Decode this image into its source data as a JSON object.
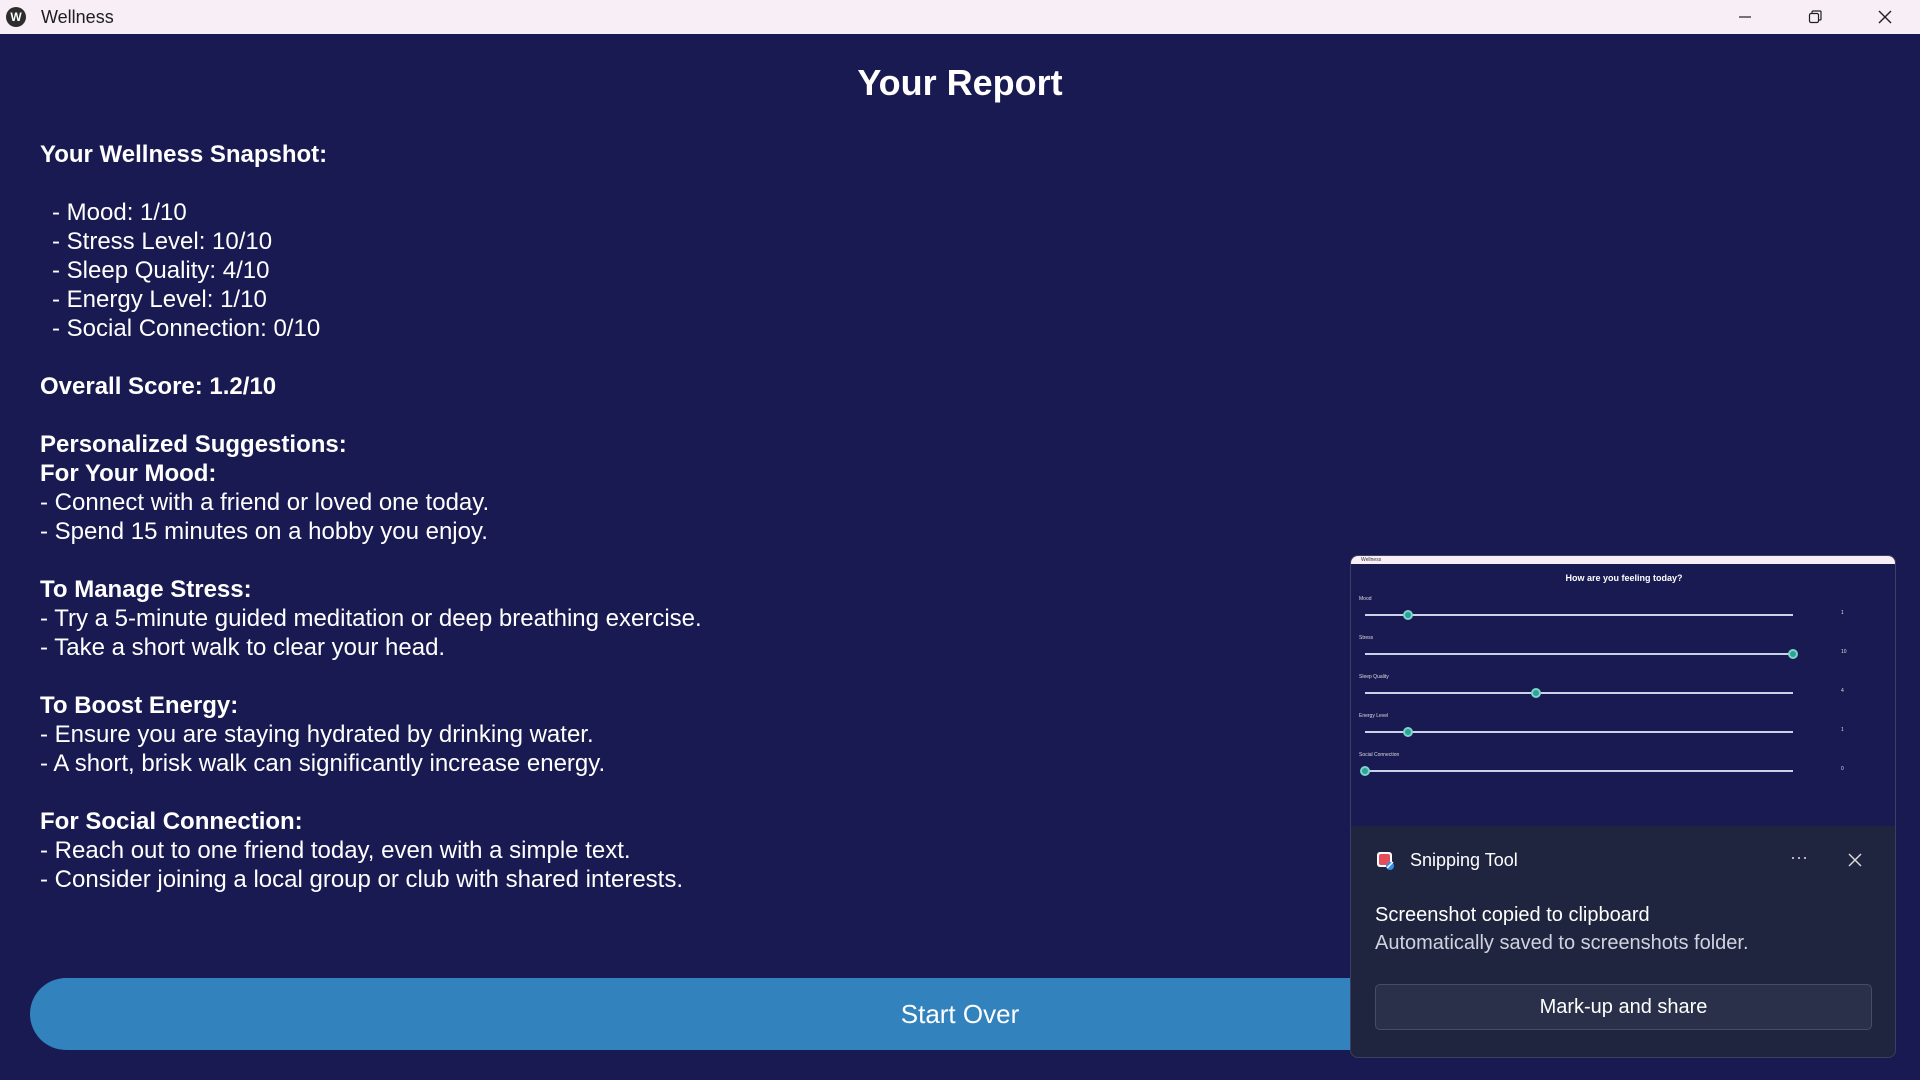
{
  "window": {
    "title": "Wellness",
    "app_icon_glyph": "W"
  },
  "report": {
    "title": "Your Report",
    "snapshot_heading": "Your Wellness Snapshot:",
    "metrics": [
      " - Mood: 1/10",
      " - Stress Level: 10/10",
      " - Sleep Quality: 4/10",
      " - Energy Level: 1/10",
      " - Social Connection: 0/10"
    ],
    "overall": "Overall Score: 1.2/10",
    "suggestions_heading": "Personalized Suggestions:",
    "sections": [
      {
        "heading": "For Your Mood:",
        "items": [
          "- Connect with a friend or loved one today.",
          "- Spend 15 minutes on a hobby you enjoy."
        ]
      },
      {
        "heading": "To Manage Stress:",
        "items": [
          "- Try a 5-minute guided meditation or deep breathing exercise.",
          "- Take a short walk to clear your head."
        ]
      },
      {
        "heading": "To Boost Energy:",
        "items": [
          "- Ensure you are staying hydrated by drinking water.",
          "- A short, brisk walk can significantly increase energy."
        ]
      },
      {
        "heading": "For Social Connection:",
        "items": [
          "- Reach out to one friend today, even with a simple text.",
          "- Consider joining a local group or club with shared interests."
        ]
      }
    ],
    "start_over_label": "Start Over"
  },
  "toast": {
    "app_name": "Snipping Tool",
    "more_label": "···",
    "message": "Screenshot copied to clipboard",
    "sub_message": "Automatically saved to screenshots folder.",
    "action_label": "Mark-up and share",
    "thumbnail": {
      "window_title": "Wellness",
      "heading": "How are you feeling today?",
      "sliders": [
        {
          "label": "Mood",
          "value": 1,
          "max": 10,
          "display": "1"
        },
        {
          "label": "Stress",
          "value": 10,
          "max": 10,
          "display": "10"
        },
        {
          "label": "Sleep Quality",
          "value": 4,
          "max": 10,
          "display": "4"
        },
        {
          "label": "Energy Level",
          "value": 1,
          "max": 10,
          "display": "1"
        },
        {
          "label": "Social Connection",
          "value": 0,
          "max": 10,
          "display": "0"
        }
      ]
    }
  },
  "colors": {
    "background": "#1a1a52",
    "button": "#3182bd",
    "titlebar": "#f7eef6",
    "slider_knob": "#2aa39a"
  }
}
